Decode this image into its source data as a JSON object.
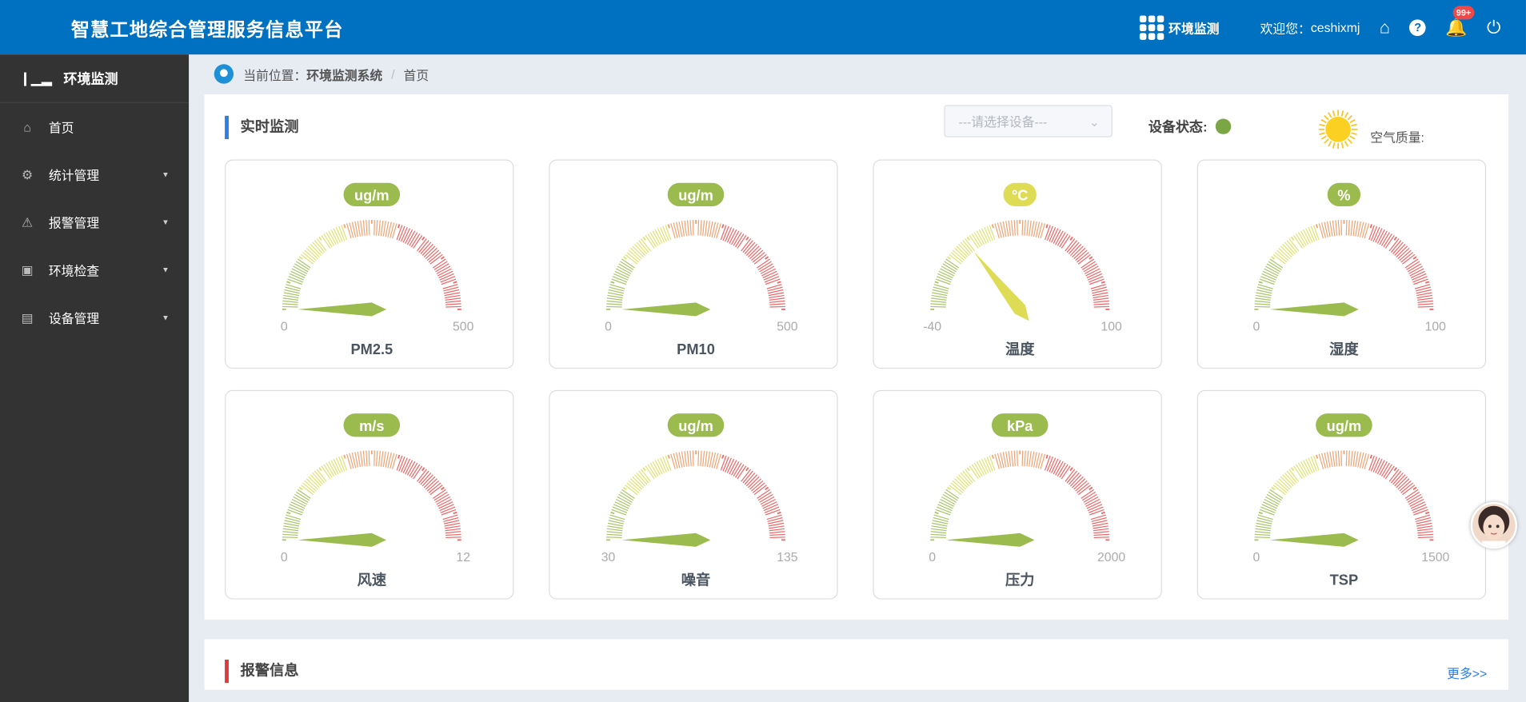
{
  "header": {
    "title": "智慧工地综合管理服务信息平台",
    "module": "环境监测",
    "welcome": "欢迎您：",
    "username": "ceshixmj",
    "notification_count": "99+"
  },
  "sidebar": {
    "title": "环境监测",
    "items": [
      {
        "label": "首页",
        "icon": "home-icon"
      },
      {
        "label": "统计管理",
        "icon": "stats-icon"
      },
      {
        "label": "报警管理",
        "icon": "alarm-icon"
      },
      {
        "label": "环境检查",
        "icon": "inspect-icon"
      },
      {
        "label": "设备管理",
        "icon": "device-icon"
      }
    ]
  },
  "breadcrumb": {
    "prefix": "当前位置：",
    "system": "环境监测系统",
    "sep": "/",
    "page": "首页"
  },
  "realtime": {
    "title": "实时监测",
    "device_placeholder": "---请选择设备---",
    "status_label": "设备状态:",
    "status_color": "#7aa646",
    "air_quality_label": "空气质量:"
  },
  "gauges": [
    {
      "name": "PM2.5",
      "unit": "ug/m",
      "min": 0,
      "max": 500,
      "value": 0
    },
    {
      "name": "PM10",
      "unit": "ug/m",
      "min": 0,
      "max": 500,
      "value": 0
    },
    {
      "name": "温度",
      "unit": "°C",
      "min": -40,
      "max": 100,
      "value": 0
    },
    {
      "name": "湿度",
      "unit": "%",
      "min": 0,
      "max": 100,
      "value": 0
    },
    {
      "name": "风速",
      "unit": "m/s",
      "min": 0,
      "max": 12,
      "value": 0
    },
    {
      "name": "噪音",
      "unit": "ug/m",
      "min": 30,
      "max": 135,
      "value": 30
    },
    {
      "name": "压力",
      "unit": "kPa",
      "min": 0,
      "max": 2000,
      "value": 0
    },
    {
      "name": "TSP",
      "unit": "ug/m",
      "min": 0,
      "max": 1500,
      "value": 0
    }
  ],
  "colors": {
    "gauge_bands": [
      "#9bbb4f",
      "#d9df5a",
      "#f0935a",
      "#ee4b4b"
    ],
    "temp_accent": "#dedc55",
    "header": "#0070c0"
  },
  "alarm": {
    "title": "报警信息",
    "more": "更多>>"
  }
}
